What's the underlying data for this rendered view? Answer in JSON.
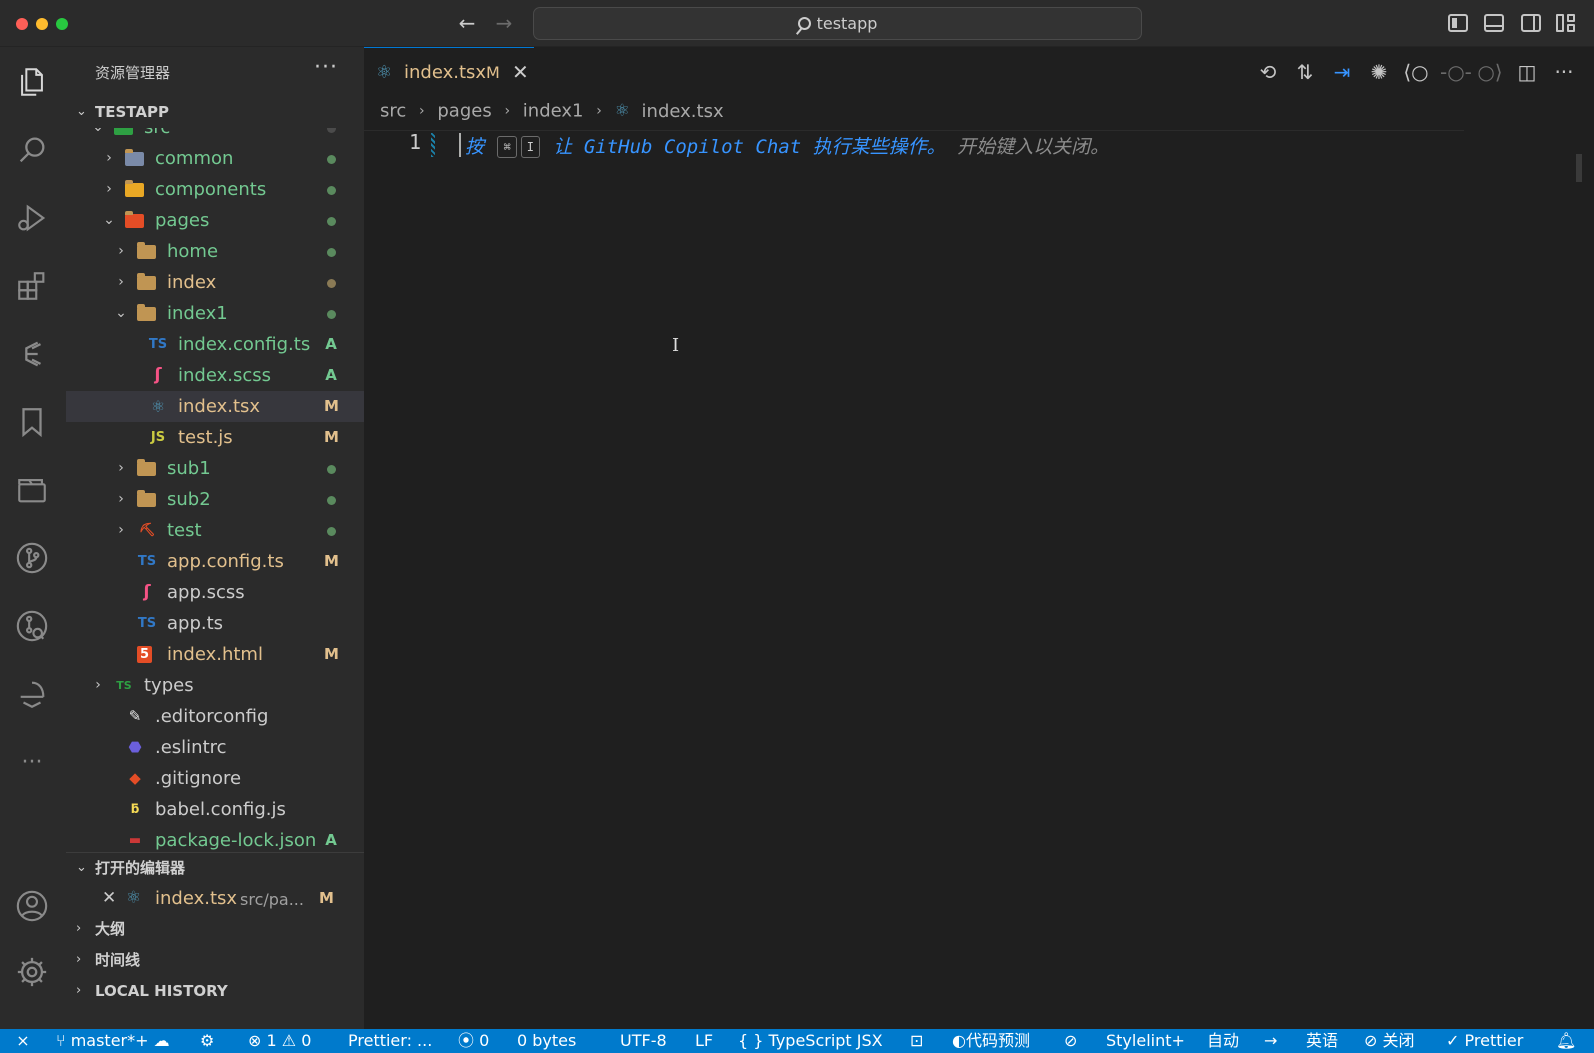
{
  "titlebar": {
    "search_text": "testapp"
  },
  "sidebar": {
    "title": "资源管理器",
    "more": "···",
    "explorer_section": "TESTAPP",
    "tree": [
      {
        "name": "src",
        "indent": 1,
        "kind": "folder-open",
        "color": "green",
        "dot": "#4b4b4b",
        "icon": "src-folder-icon"
      },
      {
        "name": "common",
        "indent": 2,
        "kind": "folder",
        "color": "green",
        "dot": "#5a8a5e",
        "icon": "common-folder-icon"
      },
      {
        "name": "components",
        "indent": 2,
        "kind": "folder",
        "color": "green",
        "dot": "#5a8a5e",
        "icon": "components-folder-icon"
      },
      {
        "name": "pages",
        "indent": 2,
        "kind": "folder-open",
        "color": "green",
        "dot": "#5a8a5e",
        "icon": "pages-folder-icon"
      },
      {
        "name": "home",
        "indent": 3,
        "kind": "folder",
        "color": "green",
        "dot": "#5a8a5e",
        "icon": "folder-icon"
      },
      {
        "name": "index",
        "indent": 3,
        "kind": "folder",
        "color": "yellow",
        "dot": "#8a7a55",
        "icon": "folder-icon"
      },
      {
        "name": "index1",
        "indent": 3,
        "kind": "folder-open",
        "color": "green",
        "dot": "#5a8a5e",
        "icon": "folder-open-icon"
      },
      {
        "name": "index.config.ts",
        "indent": 4,
        "kind": "ts",
        "color": "green",
        "badge": "A",
        "icon": "typescript-icon"
      },
      {
        "name": "index.scss",
        "indent": 4,
        "kind": "scss",
        "color": "green",
        "badge": "A",
        "icon": "sass-icon"
      },
      {
        "name": "index.tsx",
        "indent": 4,
        "kind": "react",
        "color": "yellow",
        "badge": "M",
        "icon": "react-icon",
        "selected": true
      },
      {
        "name": "test.js",
        "indent": 4,
        "kind": "js",
        "color": "yellow",
        "badge": "M",
        "icon": "javascript-icon"
      },
      {
        "name": "sub1",
        "indent": 3,
        "kind": "folder",
        "color": "green",
        "dot": "#5a8a5e",
        "icon": "folder-icon"
      },
      {
        "name": "sub2",
        "indent": 3,
        "kind": "folder",
        "color": "green",
        "dot": "#5a8a5e",
        "icon": "folder-icon"
      },
      {
        "name": "test",
        "indent": 3,
        "kind": "folder-red",
        "color": "green",
        "dot": "#5a8a5e",
        "icon": "test-folder-icon"
      },
      {
        "name": "app.config.ts",
        "indent": 3,
        "kind": "ts",
        "color": "yellow",
        "badge": "M",
        "icon": "typescript-icon"
      },
      {
        "name": "app.scss",
        "indent": 3,
        "kind": "scss",
        "color": "white",
        "icon": "sass-icon"
      },
      {
        "name": "app.ts",
        "indent": 3,
        "kind": "ts",
        "color": "white",
        "icon": "typescript-icon"
      },
      {
        "name": "index.html",
        "indent": 3,
        "kind": "html",
        "color": "yellow",
        "badge": "M",
        "icon": "html5-icon"
      },
      {
        "name": "types",
        "indent": 1,
        "kind": "folder-ts",
        "color": "white",
        "icon": "types-folder-icon"
      },
      {
        "name": ".editorconfig",
        "indent": 2,
        "kind": "editorconfig",
        "color": "white",
        "icon": "editorconfig-icon"
      },
      {
        "name": ".eslintrc",
        "indent": 2,
        "kind": "eslint",
        "color": "white",
        "icon": "eslint-icon"
      },
      {
        "name": ".gitignore",
        "indent": 2,
        "kind": "git",
        "color": "white",
        "icon": "git-icon"
      },
      {
        "name": "babel.config.js",
        "indent": 2,
        "kind": "babel",
        "color": "white",
        "icon": "babel-icon"
      },
      {
        "name": "package-lock.json",
        "indent": 2,
        "kind": "npm",
        "color": "green",
        "badge": "A",
        "icon": "npm-icon"
      }
    ],
    "open_editors_section": "打开的编辑器",
    "open_editor": {
      "name": "index.tsx",
      "path": "src/pa...",
      "badge": "M"
    },
    "outline_section": "大纲",
    "timeline_section": "时间线",
    "local_history_section": "LOCAL HISTORY"
  },
  "editor": {
    "tab": {
      "name": "index.tsx",
      "badge": "M"
    },
    "breadcrumb": [
      "src",
      "pages",
      "index1",
      "index.tsx"
    ],
    "line_number": "1",
    "hint_press": "按",
    "hint_key1": "⌘",
    "hint_key2": "I",
    "hint_action": "让 GitHub Copilot Chat 执行某些操作。",
    "hint_dismiss": "开始键入以关闭。"
  },
  "statusbar": {
    "branch": "master*+",
    "errors": "1",
    "warnings": "0",
    "prettier_short": "Prettier: ...",
    "ports": "0",
    "size": "0 bytes",
    "encoding": "UTF-8",
    "eol": "LF",
    "language": "TypeScript JSX",
    "prediction": "代码预测",
    "stylelint": "Stylelint+",
    "auto": "自动",
    "lang": "英语",
    "close": "关闭",
    "prettier": "Prettier"
  },
  "colors": {
    "accent": "#007acc",
    "modified": "#e2c08d",
    "added": "#73c991",
    "hint_blue": "#3794ff"
  }
}
